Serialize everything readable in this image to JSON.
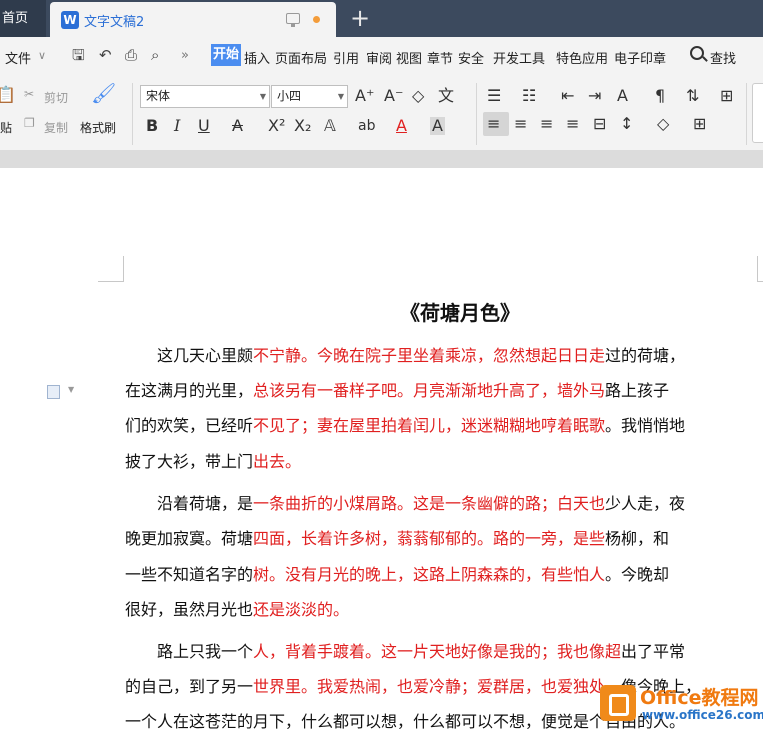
{
  "tabs": {
    "home": "首页",
    "doc": "文字文稿2",
    "doc_logo": "W",
    "new_tab": "+"
  },
  "menu": {
    "file": "文件",
    "more": "»",
    "items": [
      "开始",
      "插入",
      "页面布局",
      "引用",
      "审阅",
      "视图",
      "章节",
      "安全",
      "开发工具",
      "特色应用",
      "电子印章"
    ],
    "search": "查找"
  },
  "ribbon": {
    "cut": "剪切",
    "copy": "复制",
    "paste_partial": "贴",
    "format_painter": "格式刷",
    "font_name": "宋体",
    "font_size": "小四",
    "wen_char": "文",
    "font_color_char": "A",
    "accent_color": "#4b8df0"
  },
  "document": {
    "title": "《荷塘月色》",
    "lines": [
      {
        "segments": [
          {
            "t": "　　这几天心里颇",
            "red": false
          },
          {
            "t": "不宁静。今晚在院子里坐着乘凉，忽然想起日日走",
            "red": true
          },
          {
            "t": "过的荷塘，",
            "red": false
          }
        ]
      },
      {
        "segments": [
          {
            "t": "在这满月的光里，",
            "red": false
          },
          {
            "t": "总该另有一番样子吧。月亮渐渐地升高了，墙外马",
            "red": true
          },
          {
            "t": "路上孩子",
            "red": false
          }
        ]
      },
      {
        "segments": [
          {
            "t": "们的欢笑，已经听",
            "red": false
          },
          {
            "t": "不见了；妻在屋里拍着闰儿，迷迷糊糊地哼着眠歌",
            "red": true
          },
          {
            "t": "。我悄悄地",
            "red": false
          }
        ]
      },
      {
        "segments": [
          {
            "t": "披了大衫，带上门",
            "red": false
          },
          {
            "t": "出去。",
            "red": true
          }
        ]
      },
      {
        "segments": [
          {
            "t": "　　沿着荷塘，是",
            "red": false
          },
          {
            "t": "一条曲折的小煤屑路。这是一条幽僻的路；白天也",
            "red": true
          },
          {
            "t": "少人走，夜",
            "red": false
          }
        ]
      },
      {
        "segments": [
          {
            "t": "晚更加寂寞。荷塘",
            "red": false
          },
          {
            "t": "四面，长着许多树，蓊蓊郁郁的。路的一旁，是些",
            "red": true
          },
          {
            "t": "杨柳，和",
            "red": false
          }
        ]
      },
      {
        "segments": [
          {
            "t": "一些不知道名字的",
            "red": false
          },
          {
            "t": "树。没有月光的晚上，这路上阴森森的，有些怕人",
            "red": true
          },
          {
            "t": "。今晚却",
            "red": false
          }
        ]
      },
      {
        "segments": [
          {
            "t": "很好，虽然月光也",
            "red": false
          },
          {
            "t": "还是淡淡的。",
            "red": true
          }
        ]
      },
      {
        "segments": [
          {
            "t": "　　路上只我一个",
            "red": false
          },
          {
            "t": "人，背着手踱着。这一片天地好像是我的；我也像超",
            "red": true
          },
          {
            "t": "出了平常",
            "red": false
          }
        ]
      },
      {
        "segments": [
          {
            "t": "的自己，到了另一",
            "red": false
          },
          {
            "t": "世界里。我爱热闹，也爱冷静；爱群居，也爱独处",
            "red": true
          },
          {
            "t": "。像今晚上，",
            "red": false
          }
        ]
      },
      {
        "segments": [
          {
            "t": "一个人在这苍茫的月下，什么都可以想，什么都可以不想，便觉是个自由的人。",
            "red": false
          }
        ]
      }
    ]
  },
  "watermark": {
    "name": "Office教程网",
    "url": "www.office26.com"
  }
}
